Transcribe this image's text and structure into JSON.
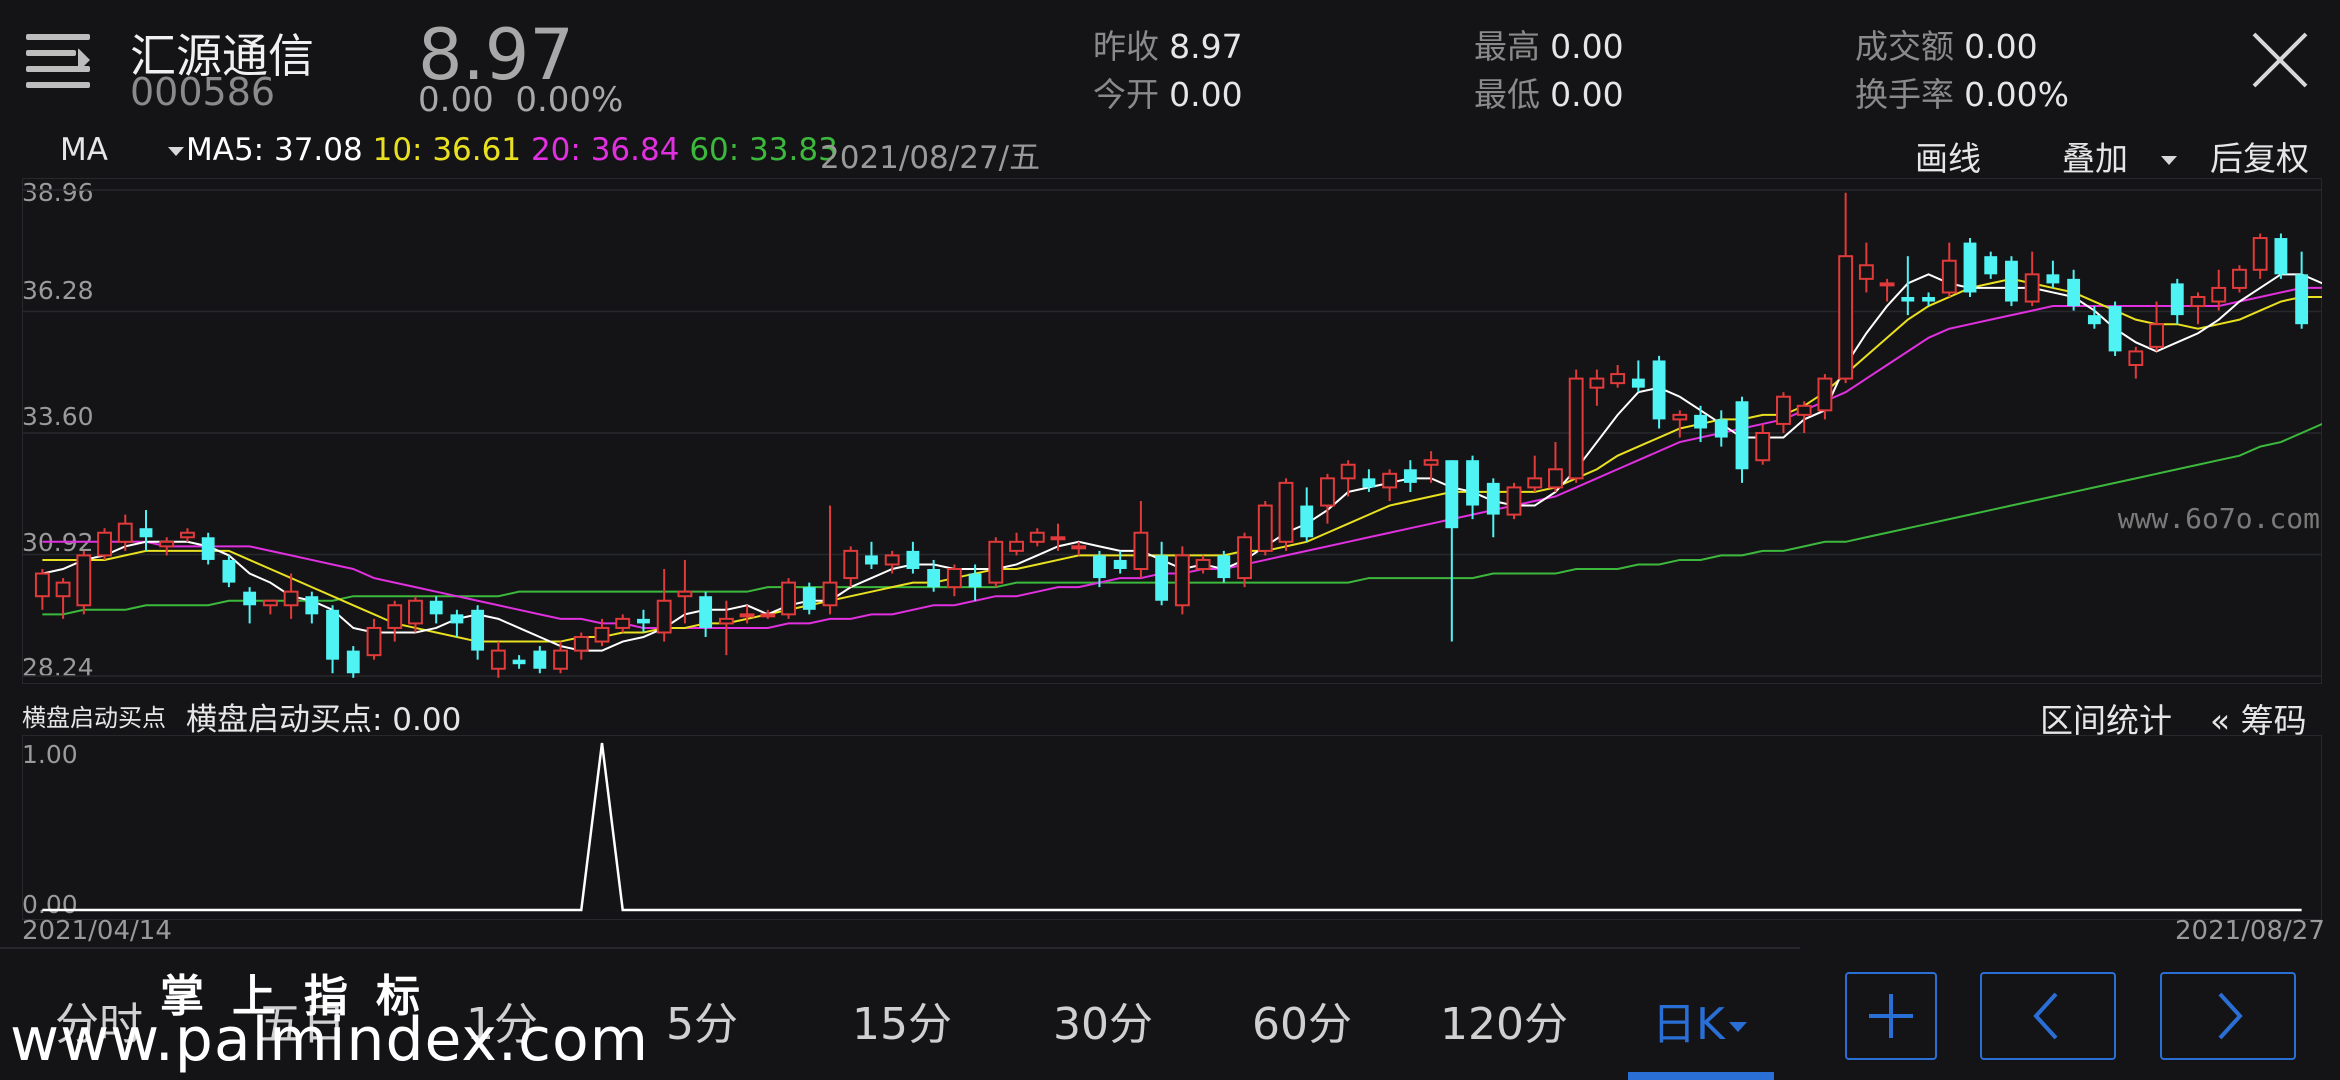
{
  "header": {
    "stock_name": "汇源通信",
    "stock_code": "000586",
    "price": "8.97",
    "change": "0.00",
    "change_pct": "0.00%",
    "stats": [
      {
        "label": "昨收",
        "value": "8.97"
      },
      {
        "label": "今开",
        "value": "0.00"
      },
      {
        "label": "最高",
        "value": "0.00"
      },
      {
        "label": "最低",
        "value": "0.00"
      },
      {
        "label": "成交额",
        "value": "0.00"
      },
      {
        "label": "换手率",
        "value": "0.00%"
      }
    ]
  },
  "ma_bar": {
    "selector": "MA",
    "ma5": "MA5: 37.08",
    "ma10": "10: 36.61",
    "ma20": "20: 36.84",
    "ma60": "60: 33.83",
    "date": "2021/08/27/五",
    "draw_line": "画线",
    "overlay": "叠加",
    "adjust": "后复权"
  },
  "colors": {
    "up": "#e03a3a",
    "down": "#4ff3f3",
    "ma5": "#ffffff",
    "ma10": "#e8e020",
    "ma20": "#e030e0",
    "ma60": "#3cb93c",
    "accent": "#2a6fd6"
  },
  "chart_data": {
    "type": "candlestick",
    "y_ticks": [
      "38.96",
      "36.28",
      "33.60",
      "30.92",
      "28.24"
    ],
    "ylim": [
      28.24,
      38.96
    ],
    "x_start": "2021/04/14",
    "x_end": "2021/08/27",
    "candles": [
      [
        30.0,
        30.5,
        29.7,
        30.6
      ],
      [
        30.0,
        30.3,
        29.5,
        30.4
      ],
      [
        29.8,
        30.9,
        29.6,
        31.0
      ],
      [
        30.9,
        31.4,
        30.8,
        31.5
      ],
      [
        31.2,
        31.6,
        31.0,
        31.8
      ],
      [
        31.5,
        31.3,
        31.0,
        31.9
      ],
      [
        31.1,
        31.2,
        30.9,
        31.3
      ],
      [
        31.3,
        31.4,
        31.2,
        31.5
      ],
      [
        31.3,
        30.8,
        30.7,
        31.4
      ],
      [
        30.8,
        30.3,
        30.2,
        30.9
      ],
      [
        30.1,
        29.8,
        29.4,
        30.2
      ],
      [
        29.8,
        29.9,
        29.6,
        29.9
      ],
      [
        29.8,
        30.1,
        29.5,
        30.5
      ],
      [
        30.0,
        29.6,
        29.4,
        30.1
      ],
      [
        29.7,
        28.6,
        28.3,
        29.8
      ],
      [
        28.8,
        28.3,
        28.2,
        28.9
      ],
      [
        28.7,
        29.3,
        28.6,
        29.5
      ],
      [
        29.3,
        29.8,
        29.0,
        29.9
      ],
      [
        29.4,
        29.9,
        29.2,
        30.0
      ],
      [
        29.9,
        29.6,
        29.4,
        30.0
      ],
      [
        29.6,
        29.4,
        29.1,
        29.7
      ],
      [
        29.7,
        28.8,
        28.6,
        29.8
      ],
      [
        28.4,
        28.8,
        28.2,
        29.0
      ],
      [
        28.6,
        28.5,
        28.4,
        28.7
      ],
      [
        28.8,
        28.4,
        28.3,
        28.9
      ],
      [
        28.4,
        28.8,
        28.3,
        29.0
      ],
      [
        28.8,
        29.1,
        28.6,
        29.2
      ],
      [
        29.0,
        29.3,
        28.9,
        29.5
      ],
      [
        29.3,
        29.5,
        29.2,
        29.6
      ],
      [
        29.5,
        29.4,
        29.2,
        29.7
      ],
      [
        29.2,
        29.9,
        29.0,
        30.6
      ],
      [
        30.0,
        30.1,
        29.4,
        30.8
      ],
      [
        30.0,
        29.3,
        29.1,
        30.1
      ],
      [
        29.4,
        29.5,
        28.7,
        29.9
      ],
      [
        29.6,
        29.6,
        29.4,
        29.8
      ],
      [
        29.6,
        29.6,
        29.5,
        29.7
      ],
      [
        29.6,
        30.3,
        29.5,
        30.4
      ],
      [
        30.2,
        29.7,
        29.6,
        30.3
      ],
      [
        29.8,
        30.3,
        29.6,
        32.0
      ],
      [
        30.4,
        31.0,
        30.2,
        31.1
      ],
      [
        30.9,
        30.7,
        30.6,
        31.2
      ],
      [
        30.7,
        30.9,
        30.5,
        31.0
      ],
      [
        31.0,
        30.6,
        30.5,
        31.2
      ],
      [
        30.6,
        30.2,
        30.1,
        30.8
      ],
      [
        30.2,
        30.6,
        30.0,
        30.7
      ],
      [
        30.5,
        30.2,
        29.9,
        30.7
      ],
      [
        30.3,
        31.2,
        30.2,
        31.3
      ],
      [
        31.0,
        31.2,
        30.9,
        31.4
      ],
      [
        31.2,
        31.4,
        31.1,
        31.5
      ],
      [
        31.3,
        31.3,
        31.0,
        31.6
      ],
      [
        31.1,
        31.1,
        30.9,
        31.2
      ],
      [
        30.9,
        30.4,
        30.2,
        31.0
      ],
      [
        30.8,
        30.6,
        30.5,
        31.0
      ],
      [
        30.6,
        31.4,
        30.4,
        32.1
      ],
      [
        30.9,
        29.9,
        29.8,
        31.2
      ],
      [
        29.8,
        30.9,
        29.6,
        31.1
      ],
      [
        30.6,
        30.8,
        30.5,
        30.9
      ],
      [
        30.9,
        30.4,
        30.3,
        31.0
      ],
      [
        30.4,
        31.3,
        30.2,
        31.4
      ],
      [
        31.0,
        32.0,
        30.9,
        32.1
      ],
      [
        31.2,
        32.5,
        31.0,
        32.6
      ],
      [
        32.0,
        31.3,
        31.2,
        32.4
      ],
      [
        32.0,
        32.6,
        31.6,
        32.7
      ],
      [
        32.6,
        32.9,
        32.2,
        33.0
      ],
      [
        32.6,
        32.4,
        32.3,
        32.8
      ],
      [
        32.4,
        32.7,
        32.1,
        32.8
      ],
      [
        32.8,
        32.5,
        32.3,
        33.0
      ],
      [
        32.9,
        33.0,
        32.5,
        33.2
      ],
      [
        33.0,
        31.5,
        29.0,
        33.0
      ],
      [
        33.0,
        32.0,
        31.7,
        33.1
      ],
      [
        32.5,
        31.8,
        31.3,
        32.6
      ],
      [
        31.8,
        32.4,
        31.7,
        32.5
      ],
      [
        32.4,
        32.6,
        32.3,
        33.1
      ],
      [
        32.4,
        32.8,
        32.3,
        33.4
      ],
      [
        32.6,
        34.8,
        32.5,
        35.0
      ],
      [
        34.6,
        34.8,
        34.2,
        35.0
      ],
      [
        34.7,
        34.9,
        34.6,
        35.1
      ],
      [
        34.8,
        34.6,
        34.5,
        35.2
      ],
      [
        35.2,
        33.9,
        33.7,
        35.3
      ],
      [
        33.9,
        34.0,
        33.5,
        34.1
      ],
      [
        34.0,
        33.7,
        33.4,
        34.2
      ],
      [
        33.9,
        33.5,
        33.3,
        34.1
      ],
      [
        34.3,
        32.8,
        32.5,
        34.4
      ],
      [
        33.0,
        33.6,
        32.9,
        33.8
      ],
      [
        33.8,
        34.4,
        33.6,
        34.5
      ],
      [
        34.0,
        34.2,
        33.6,
        34.3
      ],
      [
        34.1,
        34.8,
        33.9,
        34.9
      ],
      [
        34.8,
        37.5,
        34.7,
        38.9
      ],
      [
        37.0,
        37.3,
        36.7,
        37.8
      ],
      [
        36.9,
        36.9,
        36.5,
        37.0
      ],
      [
        36.6,
        36.5,
        36.2,
        37.5
      ],
      [
        36.6,
        36.5,
        36.4,
        36.7
      ],
      [
        36.7,
        37.4,
        36.6,
        37.8
      ],
      [
        37.8,
        36.7,
        36.6,
        37.9
      ],
      [
        37.5,
        37.1,
        37.0,
        37.6
      ],
      [
        37.4,
        36.5,
        36.4,
        37.5
      ],
      [
        36.5,
        37.1,
        36.4,
        37.6
      ],
      [
        37.1,
        36.9,
        36.8,
        37.4
      ],
      [
        37.0,
        36.4,
        36.3,
        37.2
      ],
      [
        36.2,
        36.0,
        35.9,
        36.4
      ],
      [
        36.4,
        35.4,
        35.3,
        36.5
      ],
      [
        35.1,
        35.4,
        34.8,
        35.5
      ],
      [
        35.5,
        36.0,
        35.4,
        36.5
      ],
      [
        36.9,
        36.2,
        36.0,
        37.0
      ],
      [
        36.4,
        36.6,
        36.0,
        36.7
      ],
      [
        36.5,
        36.8,
        36.3,
        37.2
      ],
      [
        36.8,
        37.2,
        36.7,
        37.3
      ],
      [
        37.2,
        37.9,
        37.0,
        38.0
      ],
      [
        37.9,
        37.1,
        37.0,
        38.0
      ],
      [
        37.1,
        36.0,
        35.9,
        37.6
      ]
    ],
    "ma5": [
      30.5,
      30.6,
      30.8,
      30.9,
      31.1,
      31.2,
      31.2,
      31.2,
      31.1,
      30.9,
      30.5,
      30.3,
      30.0,
      29.9,
      29.7,
      29.3,
      29.2,
      29.2,
      29.2,
      29.3,
      29.5,
      29.6,
      29.5,
      29.3,
      29.1,
      28.9,
      28.8,
      28.8,
      29.0,
      29.1,
      29.3,
      29.6,
      29.7,
      29.7,
      29.8,
      29.6,
      29.8,
      29.9,
      29.9,
      30.2,
      30.4,
      30.6,
      30.7,
      30.7,
      30.6,
      30.6,
      30.6,
      30.7,
      30.9,
      31.1,
      31.2,
      31.1,
      31.0,
      31.0,
      30.8,
      30.6,
      30.7,
      30.6,
      30.8,
      31.1,
      31.4,
      31.6,
      31.9,
      32.3,
      32.4,
      32.5,
      32.6,
      32.6,
      32.4,
      32.3,
      32.1,
      32.0,
      32.0,
      32.3,
      32.8,
      33.4,
      34.0,
      34.5,
      34.6,
      34.4,
      34.1,
      33.8,
      33.5,
      33.5,
      33.5,
      33.9,
      34.1,
      35.1,
      35.8,
      36.4,
      36.9,
      37.1,
      36.9,
      36.8,
      36.8,
      36.8,
      36.8,
      36.7,
      36.6,
      36.3,
      35.9,
      35.6,
      35.4,
      35.6,
      35.8,
      36.1,
      36.5,
      36.8,
      37.1,
      37.1,
      36.9
    ],
    "ma10": [
      30.8,
      30.8,
      30.8,
      30.8,
      30.9,
      31.0,
      31.0,
      31.0,
      31.0,
      31.0,
      30.8,
      30.6,
      30.4,
      30.2,
      30.0,
      29.8,
      29.6,
      29.4,
      29.3,
      29.2,
      29.1,
      29.0,
      29.0,
      29.0,
      29.0,
      29.0,
      29.1,
      29.1,
      29.2,
      29.2,
      29.3,
      29.3,
      29.4,
      29.4,
      29.5,
      29.6,
      29.7,
      29.8,
      29.9,
      30.0,
      30.1,
      30.2,
      30.3,
      30.3,
      30.4,
      30.5,
      30.6,
      30.6,
      30.7,
      30.8,
      30.9,
      30.9,
      30.9,
      30.9,
      30.9,
      30.9,
      30.9,
      30.9,
      31.0,
      31.0,
      31.1,
      31.2,
      31.4,
      31.6,
      31.8,
      32.0,
      32.1,
      32.2,
      32.3,
      32.3,
      32.3,
      32.3,
      32.3,
      32.4,
      32.6,
      32.8,
      33.1,
      33.3,
      33.5,
      33.7,
      33.8,
      33.9,
      33.9,
      34.0,
      34.0,
      34.2,
      34.5,
      34.9,
      35.3,
      35.7,
      36.1,
      36.4,
      36.6,
      36.8,
      36.9,
      37.0,
      36.9,
      36.8,
      36.7,
      36.5,
      36.3,
      36.1,
      36.0,
      36.0,
      35.9,
      36.0,
      36.1,
      36.3,
      36.5,
      36.6,
      36.6
    ],
    "ma20": [
      31.2,
      31.2,
      31.2,
      31.2,
      31.2,
      31.2,
      31.1,
      31.1,
      31.1,
      31.1,
      31.1,
      31.0,
      30.9,
      30.8,
      30.7,
      30.6,
      30.4,
      30.3,
      30.2,
      30.1,
      30.0,
      29.9,
      29.8,
      29.7,
      29.6,
      29.5,
      29.5,
      29.4,
      29.4,
      29.3,
      29.3,
      29.3,
      29.3,
      29.3,
      29.3,
      29.3,
      29.4,
      29.4,
      29.5,
      29.5,
      29.6,
      29.6,
      29.7,
      29.8,
      29.8,
      29.9,
      30.0,
      30.0,
      30.1,
      30.2,
      30.2,
      30.3,
      30.4,
      30.4,
      30.5,
      30.5,
      30.6,
      30.6,
      30.7,
      30.8,
      30.9,
      31.0,
      31.1,
      31.2,
      31.3,
      31.4,
      31.5,
      31.6,
      31.7,
      31.8,
      31.9,
      32.0,
      32.1,
      32.2,
      32.4,
      32.6,
      32.8,
      33.0,
      33.2,
      33.4,
      33.5,
      33.6,
      33.7,
      33.8,
      33.9,
      34.1,
      34.3,
      34.5,
      34.8,
      35.1,
      35.4,
      35.7,
      35.9,
      36.0,
      36.1,
      36.2,
      36.3,
      36.4,
      36.4,
      36.4,
      36.4,
      36.4,
      36.4,
      36.4,
      36.4,
      36.4,
      36.5,
      36.6,
      36.7,
      36.8,
      36.8
    ],
    "ma60": [
      29.6,
      29.6,
      29.7,
      29.7,
      29.7,
      29.8,
      29.8,
      29.8,
      29.8,
      29.9,
      29.9,
      29.9,
      29.9,
      29.9,
      29.9,
      30.0,
      30.0,
      30.0,
      30.0,
      30.0,
      30.0,
      30.0,
      30.0,
      30.1,
      30.1,
      30.1,
      30.1,
      30.1,
      30.1,
      30.1,
      30.1,
      30.1,
      30.1,
      30.1,
      30.1,
      30.2,
      30.2,
      30.2,
      30.2,
      30.2,
      30.2,
      30.2,
      30.2,
      30.2,
      30.2,
      30.2,
      30.2,
      30.3,
      30.3,
      30.3,
      30.3,
      30.3,
      30.3,
      30.3,
      30.3,
      30.3,
      30.3,
      30.3,
      30.3,
      30.3,
      30.3,
      30.3,
      30.3,
      30.3,
      30.4,
      30.4,
      30.4,
      30.4,
      30.4,
      30.4,
      30.5,
      30.5,
      30.5,
      30.5,
      30.6,
      30.6,
      30.6,
      30.7,
      30.7,
      30.8,
      30.8,
      30.9,
      30.9,
      31.0,
      31.0,
      31.1,
      31.2,
      31.2,
      31.3,
      31.4,
      31.5,
      31.6,
      31.7,
      31.8,
      31.9,
      32.0,
      32.1,
      32.2,
      32.3,
      32.4,
      32.5,
      32.6,
      32.7,
      32.8,
      32.9,
      33.0,
      33.1,
      33.3,
      33.4,
      33.6,
      33.8
    ]
  },
  "indicator": {
    "short_label": "横盘启动买点",
    "value_label": "横盘启动买点: 0.00",
    "y_top": "1.00",
    "y_bottom": "0.00",
    "interval_stats": "区间统计",
    "chips": "« 筹码",
    "spike_index": 27,
    "values_note": ""
  },
  "bottom_tabs": [
    "分时",
    "五日",
    "1分",
    "5分",
    "15分",
    "30分",
    "60分",
    "120分",
    "日K"
  ],
  "active_tab": "日K",
  "watermarks": {
    "big": "www.palmindex.com",
    "cn": "掌上指标",
    "small": "www.6o7o.com"
  },
  "icons": {
    "menu": "menu-icon",
    "close": "close-icon",
    "add": "plus-icon",
    "prev": "chevron-left-icon",
    "next": "chevron-right-icon"
  }
}
